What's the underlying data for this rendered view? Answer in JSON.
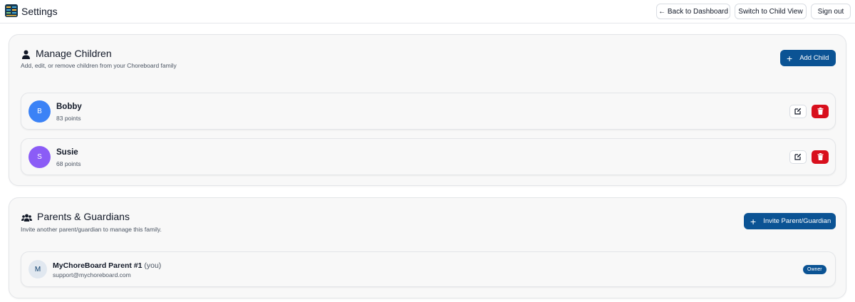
{
  "header": {
    "title": "Settings",
    "back_label": "← Back to Dashboard",
    "child_view_label": "Switch to Child View",
    "sign_out_label": "Sign out"
  },
  "children_section": {
    "title": "Manage Children",
    "subtitle": "Add, edit, or remove children from your Choreboard family",
    "add_label": "Add Child",
    "children": [
      {
        "initial": "B",
        "name": "Bobby",
        "points": "83 points",
        "color": "#3b82f6"
      },
      {
        "initial": "S",
        "name": "Susie",
        "points": "68 points",
        "color": "#8b5cf6"
      }
    ]
  },
  "parents_section": {
    "title": "Parents & Guardians",
    "subtitle": "Invite another parent/guardian to manage this family.",
    "invite_label": "Invite Parent/Guardian",
    "parents": [
      {
        "initial": "M",
        "name": "MyChoreBoard Parent #1",
        "you_label": "(you)",
        "email": "support@mychoreboard.com",
        "role": "Owner"
      }
    ]
  },
  "colors": {
    "primary": "#0b5394",
    "danger": "#d80f1c"
  }
}
